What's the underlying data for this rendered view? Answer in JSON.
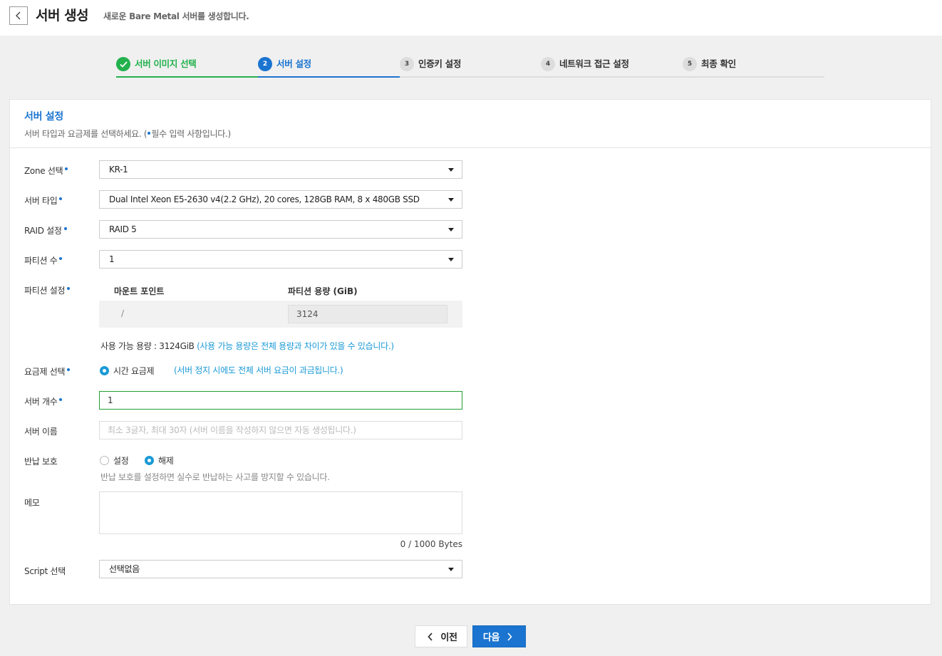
{
  "header": {
    "title": "서버 생성",
    "subtitle": "새로운 Bare Metal 서버를 생성합니다."
  },
  "steps": [
    {
      "num": "✓",
      "label": "서버 이미지 선택",
      "state": "done"
    },
    {
      "num": "2",
      "label": "서버 설정",
      "state": "active"
    },
    {
      "num": "3",
      "label": "인증키 설정",
      "state": "todo"
    },
    {
      "num": "4",
      "label": "네트워크 접근 설정",
      "state": "todo"
    },
    {
      "num": "5",
      "label": "최종 확인",
      "state": "todo"
    }
  ],
  "panel": {
    "title": "서버 설정",
    "desc_prefix": "서버 타입과 요금제를 선택하세요. (",
    "desc_suffix": "필수 입력 사항입니다.)"
  },
  "form": {
    "zone": {
      "label": "Zone 선택",
      "value": "KR-1"
    },
    "server_type": {
      "label": "서버 타입",
      "value": "Dual Intel Xeon E5-2630 v4(2.2 GHz), 20 cores, 128GB RAM, 8 x 480GB SSD"
    },
    "raid": {
      "label": "RAID 설정",
      "value": "RAID 5"
    },
    "partition_count": {
      "label": "파티션 수",
      "value": "1"
    },
    "partition": {
      "label": "파티션 설정",
      "col_mount": "마운트 포인트",
      "col_capacity": "파티션 용량 (GiB)",
      "mount": "/",
      "capacity": "3124"
    },
    "available": {
      "prefix": "사용 가능 용량 : 3124GiB ",
      "note": "(사용 가능 용량은 전체 용량과 차이가 있을 수 있습니다.)"
    },
    "plan": {
      "label": "요금제 선택",
      "option": "시간 요금제",
      "note": "(서버 정지 시에도 전체 서버 요금이 과금됩니다.)"
    },
    "count": {
      "label": "서버 개수",
      "value": "1"
    },
    "name": {
      "label": "서버 이름",
      "placeholder": "최소 3글자, 최대 30자 (서버 이름을 작성하지 않으면 자동 생성됩니다.)"
    },
    "protect": {
      "label": "반납 보호",
      "on": "설정",
      "off": "해제",
      "help": "반납 보호를 설정하면 실수로 반납하는 사고를 방지할 수 있습니다."
    },
    "memo": {
      "label": "메모",
      "counter": "0 / 1000 Bytes"
    },
    "script": {
      "label": "Script 선택",
      "value": "선택없음"
    }
  },
  "buttons": {
    "prev": "이전",
    "next": "다음"
  },
  "colors": {
    "accent": "#1a74d0",
    "done": "#22b14c",
    "note": "#1a9ad6"
  }
}
